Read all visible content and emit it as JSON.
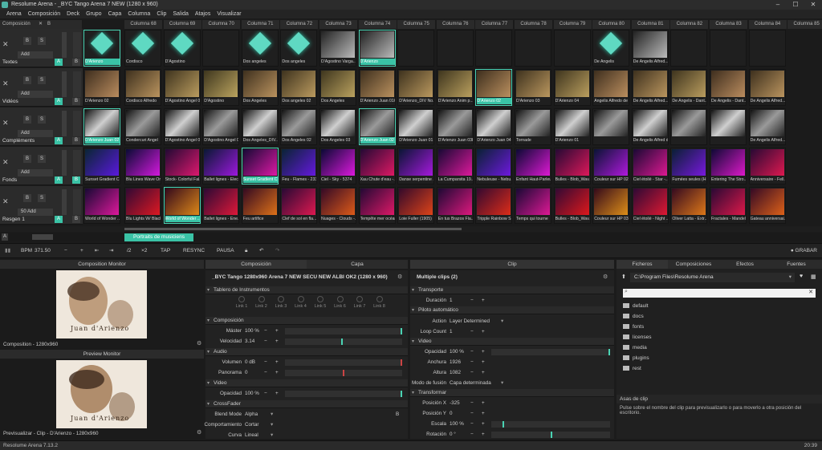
{
  "window": {
    "title": "Resolume Arena - _BYC Tango Arena 7 NEW (1280 x 960)",
    "minimize": "–",
    "maximize": "☐",
    "close": "✕"
  },
  "menu": [
    "Arena",
    "Composición",
    "Deck",
    "Grupo",
    "Capa",
    "Columna",
    "Clip",
    "Salida",
    "Atajos",
    "Visualizar"
  ],
  "composition_bar": {
    "label": "Composición",
    "x": "✕",
    "b": "B",
    "m": "M",
    "c": "C"
  },
  "columns": [
    "Columna 68",
    "Columna 69",
    "Columna 70",
    "Columna 71",
    "Columna 72",
    "Columna 73",
    "Columna 74",
    "Columna 75",
    "Columna 76",
    "Columna 77",
    "Columna 78",
    "Columna 79",
    "Columna 80",
    "Columna 81",
    "Columna 82",
    "Columna 83",
    "Columna 84",
    "Columna 85"
  ],
  "layers": [
    {
      "name": "Textes",
      "add": "Add",
      "a": "A",
      "b": "B",
      "clips": [
        "D'Arienzo",
        "Cordisco",
        "D'Agostino",
        "",
        "Dos angeles",
        "Dos angeles",
        "D'Agostino Varga...",
        "D'Arienzo",
        "",
        "",
        "",
        "",
        "",
        "De Angelis",
        "De Angelis Alfred...",
        "",
        "",
        "",
        ""
      ]
    },
    {
      "name": "Vidéos",
      "add": "Add",
      "a": "A",
      "b": "B",
      "clips": [
        "D'Arienzo 02",
        "Cordisco Alfredo",
        "D'Agostino Angel 01",
        "D'Agostino",
        "Dos Angeles",
        "Dos angeles 02",
        "Dos Angeles",
        "D'Arienzo Juan 016",
        "D'Arienzo_DIV No...",
        "D'Arienzo Anim p...",
        "D'Arienzo 02",
        "D'Arienzo 03",
        "D'Arienzo 04",
        "Angelis Alfredo de",
        "De Angelis Alfred...",
        "De Angelis - Dant...",
        "De Angelis - Dant...",
        "De Angelis Alfred...",
        "De Arielle - Darie..."
      ]
    },
    {
      "name": "Compléments",
      "add": "Add",
      "a": "A",
      "b": "B",
      "clips": [
        "D'Arienzo Juan 02",
        "Condercuri Angel",
        "D'Agostino Angel 01",
        "D'Agostino Angel 0...",
        "Dos Angeles_DIV...",
        "Dos Angeles 02",
        "Dos Angeles 03",
        "D'Arienzo Juan 02",
        "D'Arienzo Juan 01",
        "D'Arienzo Juan 03b",
        "D'Arienzo Juan 04",
        "Tornade",
        "D'Arienzo 01",
        "",
        "De Angelis Alfred de...",
        "",
        "",
        "De Angelis Alfred..."
      ]
    },
    {
      "name": "Fonds",
      "add": "Add",
      "a": "A",
      "b": "B",
      "clips": [
        "Sunset Gradient C...",
        "Blu Lines Wave Or...",
        "Stock- Colorful Fal...",
        "Ballet lignes - Elec...",
        "Sunset Gradient C...",
        "Feu - Flames - 2336",
        "Ciel - Sky - 5374",
        "Xau Chute d'eau -...",
        "Danse serpentine ...",
        "La Cumparsita 19...",
        "Nebuleuse - Nebu...",
        "Enfant Haut-Parleur",
        "Bulles - Blob_Wav...",
        "Couleur sur HP 02",
        "Ciel étoilé - Star -...",
        "Fumées seules (H...",
        "Entering The Stro...",
        "Anniversaire - Fell..."
      ]
    },
    {
      "name": "Resgen 1",
      "add": "50 Add",
      "a": "A",
      "b": "B",
      "clips": [
        "World of Wonder ...",
        "Blu Lights W/ Black",
        "World of Wonder ...",
        "Ballet lignes - Ene...",
        "Feu artifice",
        "Clef de sol en fla...",
        "Nuages - Clouds -...",
        "Tempête mer océan",
        "Loie Fuller (1905)",
        "En tus Brazos Fla...",
        "Tripple Rainbow S...",
        "Temps qui tourne",
        "Bulles - Blob_Wav...",
        "Couleur sur HP 03",
        "Ciel étoilé - Night ...",
        "Oliver Latta - Extr...",
        "Fractales - Mandel...",
        "Gateau anniversai..."
      ]
    }
  ],
  "deck_tab": "Portraits de musiciens",
  "transport": {
    "bpm_label": "BPM",
    "bpm_value": "371.50",
    "minus": "−",
    "plus": "+",
    "div2": "/2",
    "mul2": "×2",
    "tap": "TAP",
    "resync": "RESYNC",
    "pause": "PAUSA",
    "record": "● GRABAR"
  },
  "composition_monitor": {
    "title": "Composition Monitor",
    "footer": "Composition - 1280x960",
    "caption": "Juan d'Arienzo"
  },
  "preview_monitor": {
    "title": "Preview Monitor",
    "footer": "Previsualizar - Clip - D'Arienzo - 1280x960",
    "caption": "Juan d'Arienzo"
  },
  "comp_panel": {
    "tab1": "Composición",
    "tab2": "Capa",
    "title": "_BYC Tango 1280x960 Arena 7 NEW SECU NEW ALBI OK2 (1280 x 960)",
    "dashboard": "Tablero de Instrumentos",
    "links": [
      "Link 1",
      "Link 2",
      "Link 3",
      "Link 4",
      "Link 5",
      "Link 6",
      "Link 7",
      "Link 8"
    ],
    "sections": {
      "composicion": "Composición",
      "audio": "Audio",
      "video": "Video",
      "crossfader": "CrossFader"
    },
    "props": {
      "master_k": "Máster",
      "master_v": "100 %",
      "speed_k": "Velocidad",
      "speed_v": "3.14",
      "vol_k": "Volumen",
      "vol_v": "0 dB",
      "pan_k": "Panorama",
      "pan_v": "0",
      "op_k": "Opacidad",
      "op_v": "100 %",
      "blend_k": "Blend Mode",
      "blend_v": "Alpha",
      "comp_k": "Comportamiento",
      "comp_v": "Cortar",
      "curve_k": "Curva",
      "curve_v": "Lineal"
    }
  },
  "clip_panel": {
    "tab": "Clip",
    "title": "Multiple clips (2)",
    "sections": {
      "transport": "Transporte",
      "autopilot": "Piloto automático",
      "video": "Video",
      "transform": "Transformar"
    },
    "props": {
      "dur_k": "Duración",
      "dur_v": "1",
      "action_k": "Action",
      "action_v": "Layer Determined",
      "loop_k": "Loop Count",
      "loop_v": "1",
      "op_k": "Opacidad",
      "op_v": "100 %",
      "w_k": "Anchura",
      "w_v": "1926",
      "h_k": "Altura",
      "h_v": "1082",
      "fuse_k": "Modo de fusión",
      "fuse_v": "Capa determinada",
      "px_k": "Posición X",
      "px_v": "-325",
      "py_k": "Posición Y",
      "py_v": "0",
      "scale_k": "Escala",
      "scale_v": "100 %",
      "rot_k": "Rotación",
      "rot_v": "0 °"
    }
  },
  "browser": {
    "tabs": [
      "Ficheros",
      "Composiciones",
      "Efectos",
      "Fuentes"
    ],
    "path": "C:\\Program Files\\Resolume Arena",
    "folders": [
      "default",
      "docs",
      "fonts",
      "licenses",
      "media",
      "plugins",
      "rest"
    ],
    "handles_title": "Asas de clip",
    "handles_text": "Pulse sobre el nombre del clip para previsualizarlo o para moverlo a otra posición del escritorio."
  },
  "status": {
    "version": "Resolume Arena 7.13.2",
    "time": "20:39"
  },
  "colors": {
    "accent": "#3ac3a6",
    "bg": "#1b1b1b"
  }
}
